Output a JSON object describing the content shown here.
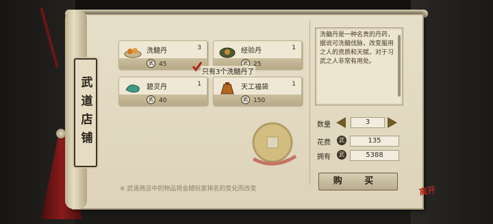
{
  "shop": {
    "title": "武道店铺",
    "items": [
      {
        "name": "洗髓丹",
        "qty": "3",
        "price": "45"
      },
      {
        "name": "经验丹",
        "qty": "1",
        "price": "25"
      },
      {
        "name": "碧灵丹",
        "qty": "1",
        "price": "40"
      },
      {
        "name": "天工福袋",
        "qty": "1",
        "price": "150"
      }
    ],
    "coin_label": "武",
    "tooltip": "只有3个洗髓丹了",
    "description": "洗髓丹是一种名贵的丹药，据说可洗髓伐脉，改变服用之人的资质和天赋，对于习武之人非常有用处。",
    "quantity_label": "数量",
    "quantity_value": "3",
    "cost_label": "花费",
    "cost_value": "135",
    "owned_label": "拥有",
    "owned_value": "5388",
    "buy_label": "购 买",
    "notice": "※ 武道商店中的物品将会随玩家排名的变化而改变",
    "leave_label": "离开"
  }
}
